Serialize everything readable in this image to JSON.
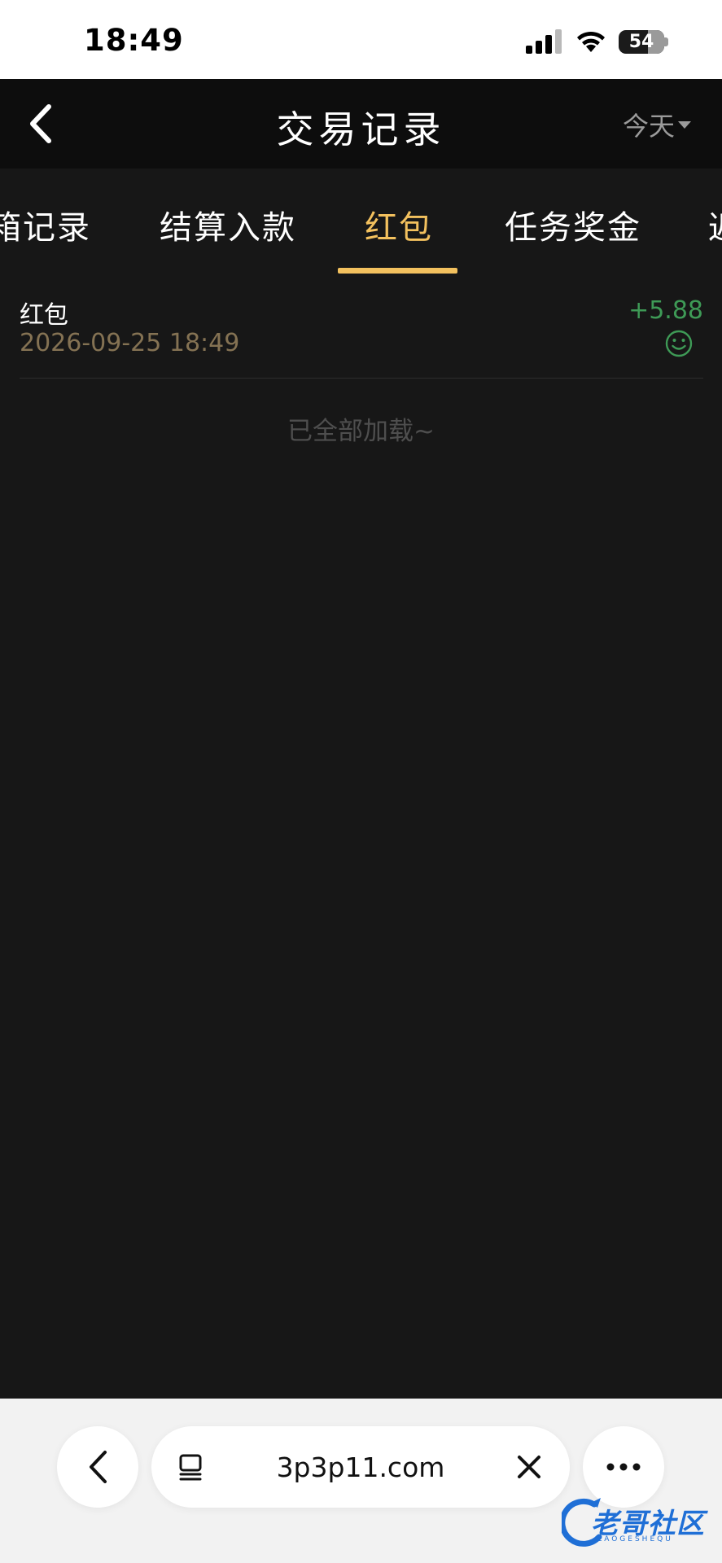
{
  "status_bar": {
    "time": "18:49",
    "battery": "54"
  },
  "header": {
    "title": "交易记录",
    "date_filter": "今天"
  },
  "tabs": [
    {
      "label": "箱记录"
    },
    {
      "label": "结算入款"
    },
    {
      "label": "红包"
    },
    {
      "label": "任务奖金"
    },
    {
      "label": "返"
    }
  ],
  "active_tab": "红包",
  "records": [
    {
      "title": "红包",
      "time": "2026-09-25 18:49",
      "amount": "+5.88"
    }
  ],
  "end_note": "已全部加载~",
  "browser": {
    "url": "3p3p11.com"
  },
  "watermark": {
    "text": "老哥社区",
    "sub": "LAOGESHEQU"
  },
  "colors": {
    "accent": "#f3c15e",
    "amount": "#3e9a56",
    "background": "#171717"
  }
}
